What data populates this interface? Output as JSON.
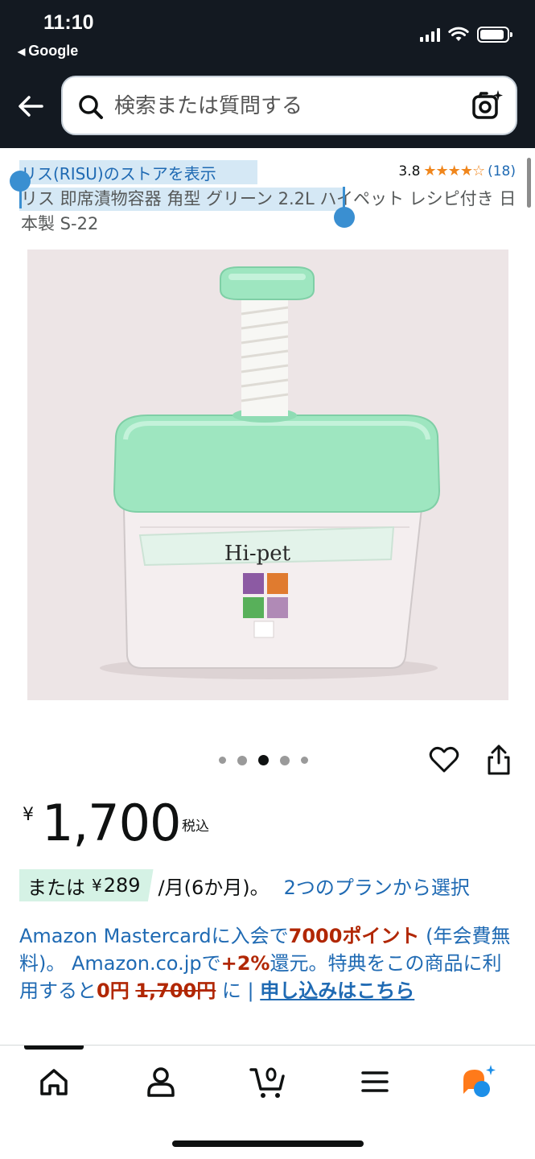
{
  "status_bar": {
    "time": "11:10",
    "back_app": "Google"
  },
  "search": {
    "placeholder": "検索または質問する"
  },
  "product": {
    "store_link": "リス(RISU)のストアを表示",
    "rating_value": "3.8",
    "rating_stars": "★★★★☆",
    "rating_count": "(18)",
    "title": "リス 即席漬物容器 角型 グリーン 2.2L ハイペット レシピ付き 日本製 S-22",
    "image_label": "Hi-pet",
    "carousel_total": 5,
    "carousel_active": 3
  },
  "price": {
    "symbol": "¥",
    "amount": "1,700",
    "tax": "税込"
  },
  "installment": {
    "prefix": "または",
    "yen": "¥",
    "amount": "289",
    "suffix": "/月(6か月)。",
    "plan_link": "2つのプランから選択"
  },
  "card_promo": {
    "part1": "Amazon Mastercardに入会で",
    "points": "7000ポイント",
    "part2": " (年会費無料)。 Amazon.co.jpで",
    "rate": "+2%",
    "part3": "還元。特典をこの商品に利用すると",
    "zero": "0円",
    "space": " ",
    "original": "1,700円",
    "part4": " に | ",
    "apply_link": "申し込みはこちら"
  },
  "colors": {
    "header_bg": "#131921",
    "link": "#1f6ab3",
    "star": "#f0861c",
    "deal_red": "#b12704",
    "install_bg": "#d5f2e5",
    "product_green": "#9ee6c0"
  }
}
